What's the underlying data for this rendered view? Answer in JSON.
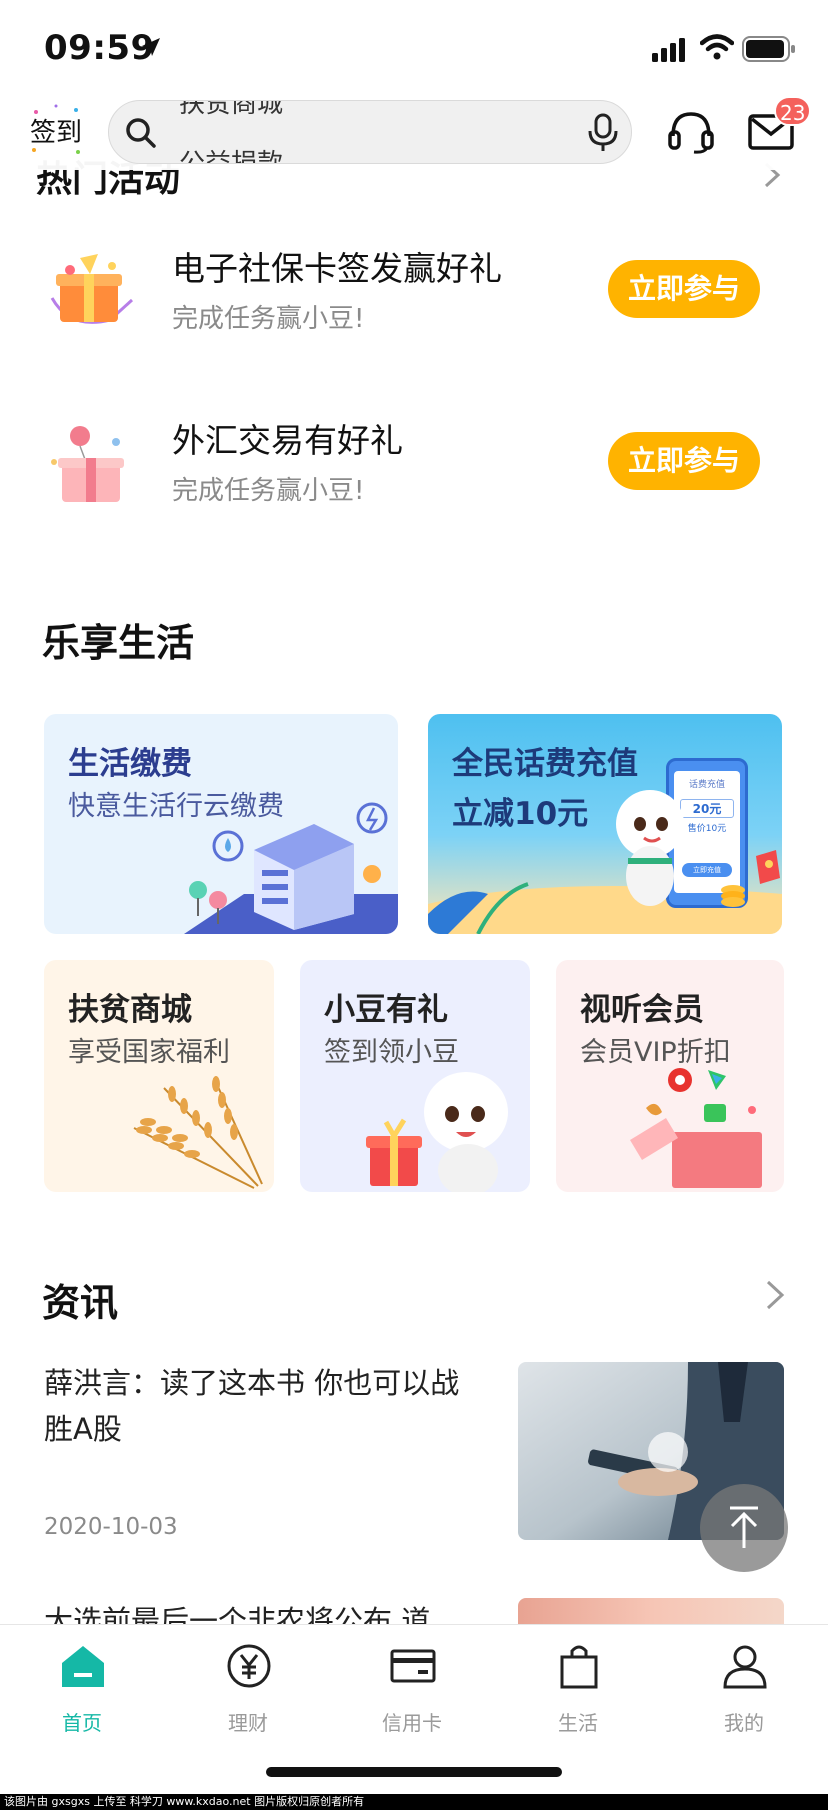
{
  "status_bar": {
    "time": "09:59"
  },
  "header": {
    "signin_label": "签到",
    "search_text_top": "扶贫商城",
    "search_text_bottom": "公益捐款",
    "mail_badge": "23"
  },
  "hidden_section": {
    "title": "热门活动"
  },
  "activities": [
    {
      "title": "电子社保卡签发赢好礼",
      "subtitle": "完成任务赢小豆!",
      "button": "立即参与"
    },
    {
      "title": "外汇交易有好礼",
      "subtitle": "完成任务赢小豆!",
      "button": "立即参与"
    }
  ],
  "life": {
    "title": "乐享生活",
    "cards": [
      {
        "title": "生活缴费",
        "subtitle": "快意生活行云缴费"
      },
      {
        "title": "全民话费充值",
        "subtitle": "立减10元",
        "phone_label": "话费充值",
        "phone_amount": "20元",
        "phone_price": "售价10元",
        "phone_button": "立即充值"
      },
      {
        "title": "扶贫商城",
        "subtitle": "享受国家福利"
      },
      {
        "title": "小豆有礼",
        "subtitle": "签到领小豆"
      },
      {
        "title": "视听会员",
        "subtitle": "会员VIP折扣"
      }
    ]
  },
  "news": {
    "title": "资讯",
    "items": [
      {
        "title": "薛洪言：读了这本书 你也可以战胜A股",
        "date": "2020-10-03"
      },
      {
        "title": "大选前最后一个非农将公布 道"
      }
    ]
  },
  "tabbar": {
    "items": [
      {
        "label": "首页"
      },
      {
        "label": "理财"
      },
      {
        "label": "信用卡"
      },
      {
        "label": "生活"
      },
      {
        "label": "我的"
      }
    ]
  },
  "watermark": "该图片由 gxsgxs 上传至 科学刀 www.kxdao.net 图片版权归原创者所有",
  "colors": {
    "accent": "#15b8a6",
    "button": "#ffb300",
    "badge": "#f4615c"
  }
}
